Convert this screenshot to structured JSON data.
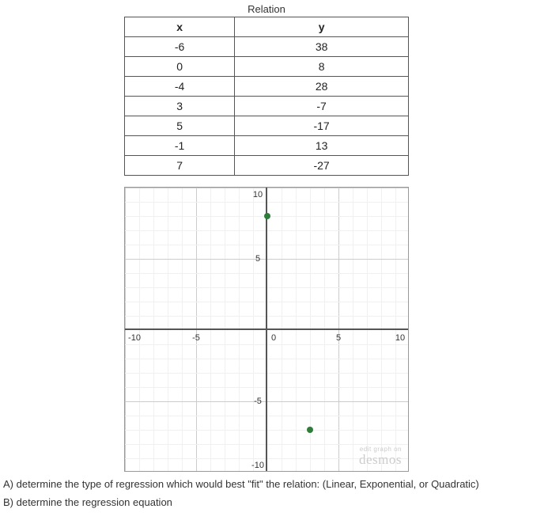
{
  "table": {
    "title": "Relation",
    "cols": [
      "x",
      "y"
    ],
    "rows": [
      {
        "x": "-6",
        "y": "38"
      },
      {
        "x": "0",
        "y": "8"
      },
      {
        "x": "-4",
        "y": "28"
      },
      {
        "x": "3",
        "y": "-7"
      },
      {
        "x": "5",
        "y": "-17"
      },
      {
        "x": "-1",
        "y": "13"
      },
      {
        "x": "7",
        "y": "-27"
      }
    ]
  },
  "graph": {
    "xmin": -10,
    "xmax": 10,
    "ymin": -10,
    "ymax": 10,
    "ticks_x": [
      -10,
      -5,
      0,
      5,
      10
    ],
    "ticks_y": [
      -10,
      -5,
      5,
      10
    ],
    "points": [
      {
        "x": 0,
        "y": 8
      },
      {
        "x": 3,
        "y": -7
      }
    ],
    "brand_small": "edit graph on",
    "brand_big": "desmos"
  },
  "questions": {
    "a": "A) determine the type of regression which would best \"fit\" the relation: (Linear, Exponential, or Quadratic)",
    "b": "B) determine the regression equation"
  },
  "chart_data": {
    "type": "scatter",
    "title": "",
    "xlabel": "",
    "ylabel": "",
    "xlim": [
      -10,
      10
    ],
    "ylim": [
      -10,
      10
    ],
    "x": [
      0,
      3
    ],
    "y": [
      8,
      -7
    ],
    "grid": true,
    "related_table": [
      {
        "x": -6,
        "y": 38
      },
      {
        "x": 0,
        "y": 8
      },
      {
        "x": -4,
        "y": 28
      },
      {
        "x": 3,
        "y": -7
      },
      {
        "x": 5,
        "y": -17
      },
      {
        "x": -1,
        "y": 13
      },
      {
        "x": 7,
        "y": -27
      }
    ]
  }
}
